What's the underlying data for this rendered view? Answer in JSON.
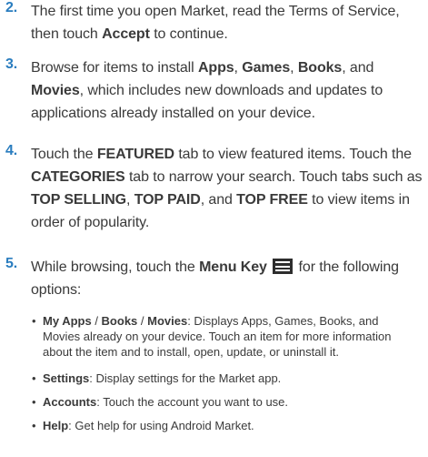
{
  "steps": [
    {
      "number": "2.",
      "lines": [
        [
          "The first time you open Market, read the Terms of Service,"
        ],
        [
          "then touch ",
          {
            "b": "Accept"
          },
          " to continue."
        ]
      ]
    },
    {
      "number": "3.",
      "lines": [
        [
          "Browse for items to install ",
          {
            "b": "Apps"
          },
          ", ",
          {
            "b": "Games"
          },
          ", ",
          {
            "b": "Books"
          },
          ", and"
        ],
        [
          {
            "b": "Movies"
          },
          ", which includes new downloads and updates to"
        ],
        [
          "applications already installed on your device."
        ]
      ]
    },
    {
      "number": "4.",
      "lines": [
        [
          "Touch the ",
          {
            "b": "FEATURED"
          },
          " tab to view featured items. Touch the"
        ],
        [
          {
            "b": "CATEGORIES"
          },
          " tab to narrow your search. Touch tabs such as"
        ],
        [
          {
            "b": "TOP SELLING"
          },
          ", ",
          {
            "b": "TOP PAID"
          },
          ", and ",
          {
            "b": "TOP FREE"
          },
          " to view items in"
        ],
        [
          "order of popularity."
        ]
      ]
    },
    {
      "number": "5.",
      "lines": [
        [
          "While browsing, touch the ",
          {
            "b": "Menu Key"
          },
          " ",
          {
            "icon": "menu-key-icon"
          },
          " for the following"
        ],
        [
          "options:"
        ]
      ]
    }
  ],
  "bullets": [
    {
      "lines": [
        [
          {
            "b": "My Apps"
          },
          " / ",
          {
            "b": "Books"
          },
          " / ",
          {
            "b": "Movies"
          },
          ": Displays Apps, Games, Books, and"
        ],
        [
          "Movies already on your device. Touch an item for more information"
        ],
        [
          "about the item and to install, open, update, or uninstall it."
        ]
      ]
    },
    {
      "lines": [
        [
          {
            "b": "Settings"
          },
          ": Display settings for the Market app."
        ]
      ]
    },
    {
      "lines": [
        [
          {
            "b": "Accounts"
          },
          ": Touch the account you want to use."
        ]
      ]
    },
    {
      "lines": [
        [
          {
            "b": "Help"
          },
          ": Get help for using Android Market."
        ]
      ]
    }
  ],
  "bullet_glyph": "•",
  "colors": {
    "step_number": "#2a7dbf",
    "text": "#3a3a3a",
    "menu_key_bg": "#2d2d2d"
  }
}
